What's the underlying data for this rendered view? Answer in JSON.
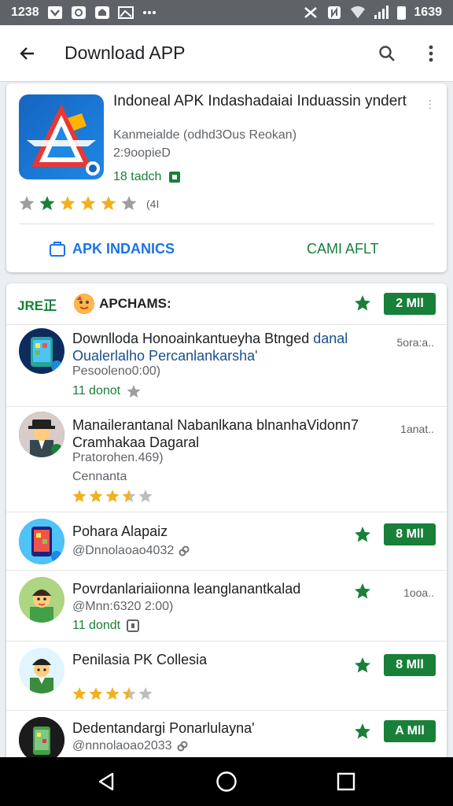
{
  "status_bar": {
    "time_left": "1238",
    "time_right": "1639"
  },
  "app_bar": {
    "title": "Download APP"
  },
  "hero": {
    "app_name": "Indoneal APK Indashadaiai Induassin yndert",
    "developer": "Kanmeialde (odhd3Ous Reokan)",
    "size": "2:9oopieD",
    "downloads": "18 tadch",
    "rating_label": "(4I",
    "rating_stars": 4,
    "button_left": "APK INDANICS",
    "button_right": "CAMI AFLT",
    "dots": "⋮"
  },
  "list_header": {
    "tag": "JRE正",
    "section": "APCHAMS:",
    "pill": "2 Mll"
  },
  "rows": [
    {
      "name": "Downlloda Honoainkantueyha Btnged",
      "name_hl": "danal",
      "name2": "Oualerlalho Percanlankarsha'",
      "sub": "Pesooleno0:00)",
      "meta": "11 donot",
      "right": "5ora:a.."
    },
    {
      "name": "Manailerantanal Nabanlkana blnanhaVidonn7",
      "name2": "Cramhakaa Dagaral",
      "sub": "Pratorohen.469)",
      "sub2": "Cennanta",
      "right": "1anat..",
      "stars": 3.5
    },
    {
      "name": "Pohara Alapaiz",
      "sub": "@Dnnolaoao4032",
      "pill": "8 Mll"
    },
    {
      "name": "Povrdanlariaiionna leanglanantkalad",
      "sub": "@Mnn:6320 2:00)",
      "meta": "11 dondt",
      "right": "1ooa.."
    },
    {
      "name": "Penilasia PK Collesia",
      "pill": "8 Mll",
      "stars": 3.5
    },
    {
      "name": "Dedentandargi Ponarlulayna'",
      "sub": "@nnnolaoao2033",
      "pill": "A Mll"
    }
  ],
  "colors": {
    "accent_green": "#188038",
    "accent_blue": "#1a73e8",
    "star_yellow": "#f2b01e",
    "status_bar": "#5f6368"
  }
}
